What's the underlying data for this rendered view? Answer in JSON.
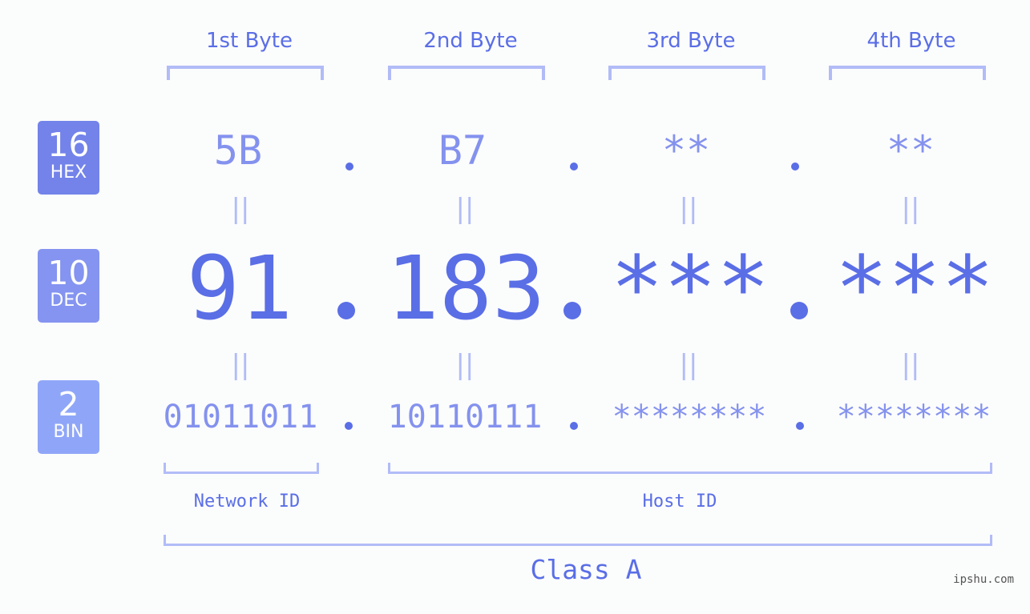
{
  "bases": [
    {
      "number": "16",
      "label": "HEX",
      "color": "#7383ea"
    },
    {
      "number": "10",
      "label": "DEC",
      "color": "#8494f0"
    },
    {
      "number": "2",
      "label": "BIN",
      "color": "#8fa6f8"
    }
  ],
  "bytes": [
    {
      "header": "1st Byte",
      "hex": "5B",
      "dec": "91",
      "bin": "01011011"
    },
    {
      "header": "2nd Byte",
      "hex": "B7",
      "dec": "183",
      "bin": "10110111"
    },
    {
      "header": "3rd Byte",
      "hex": "**",
      "dec": "***",
      "bin": "********"
    },
    {
      "header": "4th Byte",
      "hex": "**",
      "dec": "***",
      "bin": "********"
    }
  ],
  "equals_sign": "||",
  "network_id_label": "Network ID",
  "host_id_label": "Host ID",
  "class_label": "Class A",
  "watermark": "ipshu.com",
  "colors": {
    "accent": "#5a6ee6",
    "light": "#8492ee",
    "bracket": "#b1bcf7",
    "background": "#fbfcfc"
  }
}
